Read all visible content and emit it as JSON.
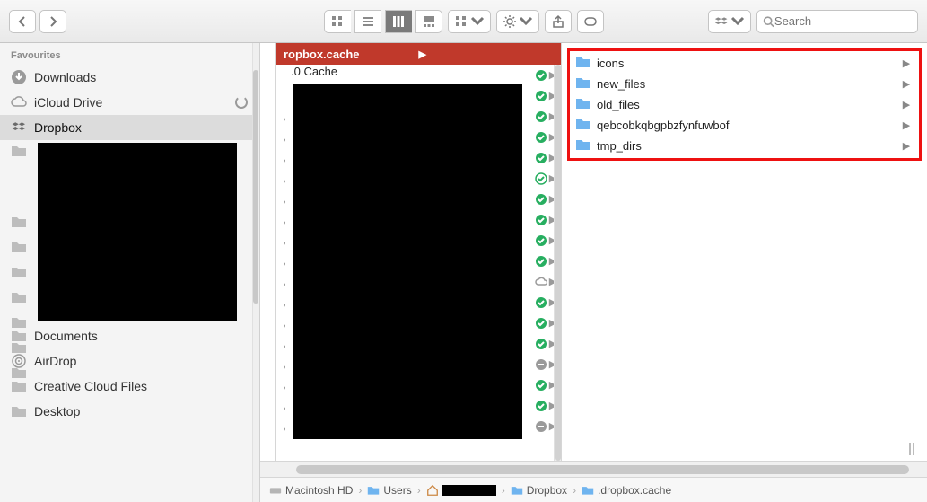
{
  "toolbar": {
    "search_placeholder": "Search"
  },
  "sidebar": {
    "section": "Favourites",
    "items_top": [
      {
        "label": "Downloads",
        "icon": "download"
      },
      {
        "label": "iCloud Drive",
        "icon": "cloud",
        "status": "syncing"
      },
      {
        "label": "Dropbox",
        "icon": "dropbox",
        "selected": true
      }
    ],
    "items_bottom": [
      {
        "label": "Documents"
      },
      {
        "label": "AirDrop",
        "icon": "airdrop"
      },
      {
        "label": "Creative Cloud Files"
      },
      {
        "label": "Desktop"
      }
    ]
  },
  "col2": {
    "header": "ropbox.cache",
    "cache_row_label": ".0 Cache",
    "rows": [
      {
        "badge": "green",
        "arrow": true
      },
      {
        "badge": "green",
        "arrow": true
      },
      {
        "badge": "green",
        "arrow": true
      },
      {
        "badge": "green",
        "arrow": true
      },
      {
        "badge": "green",
        "arrow": true
      },
      {
        "badge": "green_open",
        "arrow": true
      },
      {
        "badge": "green",
        "arrow": true
      },
      {
        "badge": "green",
        "arrow": true
      },
      {
        "badge": "green",
        "arrow": true
      },
      {
        "badge": "green",
        "arrow": true
      },
      {
        "badge": "cloud",
        "arrow": true
      },
      {
        "badge": "green",
        "arrow": true
      },
      {
        "badge": "green",
        "arrow": true
      },
      {
        "badge": "green",
        "arrow": true
      },
      {
        "badge": "grey",
        "arrow": true
      },
      {
        "badge": "green",
        "arrow": true
      },
      {
        "badge": "green",
        "arrow": true
      },
      {
        "badge": "grey",
        "arrow": true
      }
    ]
  },
  "col3": {
    "items": [
      {
        "label": "icons"
      },
      {
        "label": "new_files"
      },
      {
        "label": "old_files"
      },
      {
        "label": "qebcobkqbgpbzfynfuwbof"
      },
      {
        "label": "tmp_dirs"
      }
    ]
  },
  "pathbar": {
    "segments": [
      {
        "label": "Macintosh HD",
        "icon": "disk"
      },
      {
        "label": "Users",
        "icon": "bluefolder"
      },
      {
        "label": "",
        "icon": "home",
        "redacted": true
      },
      {
        "label": "Dropbox",
        "icon": "bluefolder"
      },
      {
        "label": ".dropbox.cache",
        "icon": "bluefolder"
      }
    ]
  }
}
